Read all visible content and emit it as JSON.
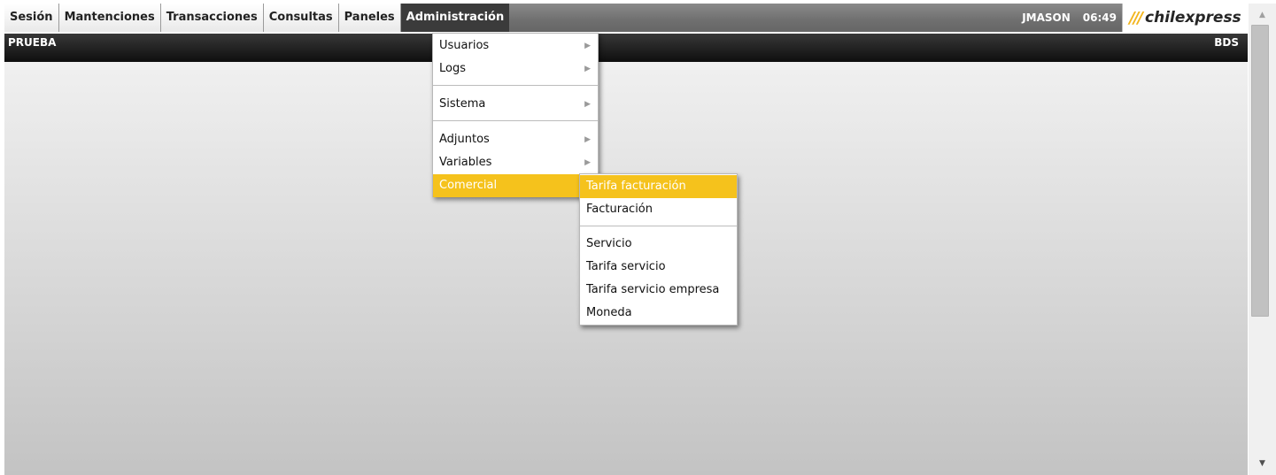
{
  "menubar": {
    "items": [
      {
        "label": "Sesión"
      },
      {
        "label": "Mantenciones"
      },
      {
        "label": "Transacciones"
      },
      {
        "label": "Consultas"
      },
      {
        "label": "Paneles"
      },
      {
        "label": "Administración",
        "active": true
      }
    ],
    "user": "JMASON",
    "clock": "06:49",
    "logo_text": "chilexpress",
    "logo_mark": "///"
  },
  "subbar": {
    "left": "PRUEBA",
    "right": "BDS"
  },
  "admin_menu": {
    "items": [
      {
        "label": "Usuarios"
      },
      {
        "label": "Logs"
      },
      {
        "label": "Sistema"
      },
      {
        "label": "Adjuntos"
      },
      {
        "label": "Variables"
      },
      {
        "label": "Comercial",
        "highlighted": true
      }
    ],
    "submenu_arrow": "▶"
  },
  "comercial_menu": {
    "items": [
      {
        "label": "Tarifa facturación",
        "highlighted": true
      },
      {
        "label": "Facturación"
      },
      {
        "label": "Servicio"
      },
      {
        "label": "Tarifa servicio"
      },
      {
        "label": "Tarifa servicio empresa"
      },
      {
        "label": "Moneda"
      }
    ]
  },
  "scrollbar": {
    "up_arrow": "▲",
    "down_arrow": "▼"
  },
  "colors": {
    "highlight": "#f5c21c",
    "active_menu": "#3b3b3b",
    "logo_accent": "#f2b51d"
  }
}
